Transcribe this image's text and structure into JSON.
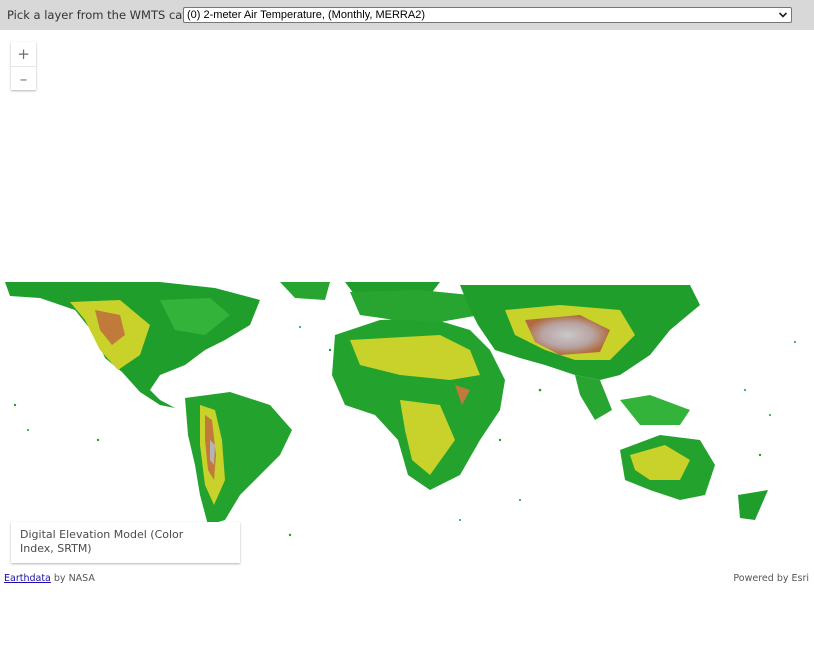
{
  "toolbar": {
    "label": "Pick a layer from the WMTS catalog",
    "selected_layer": "(0) 2-meter Air Temperature, (Monthly, MERRA2)"
  },
  "zoom": {
    "in_label": "+",
    "out_label": "–"
  },
  "map": {
    "basemap": "elevation-color-world-map",
    "colors": {
      "lowland": "#1a9a2a",
      "midland": "#c8d22a",
      "highland": "#c07a3a",
      "peaks": "#bdbdbd"
    }
  },
  "legend": {
    "title": "Digital Elevation Model (Color Index, SRTM)"
  },
  "attribution": {
    "link_text": "Earthdata",
    "by_text": " by NASA",
    "powered_by": "Powered by Esri"
  }
}
